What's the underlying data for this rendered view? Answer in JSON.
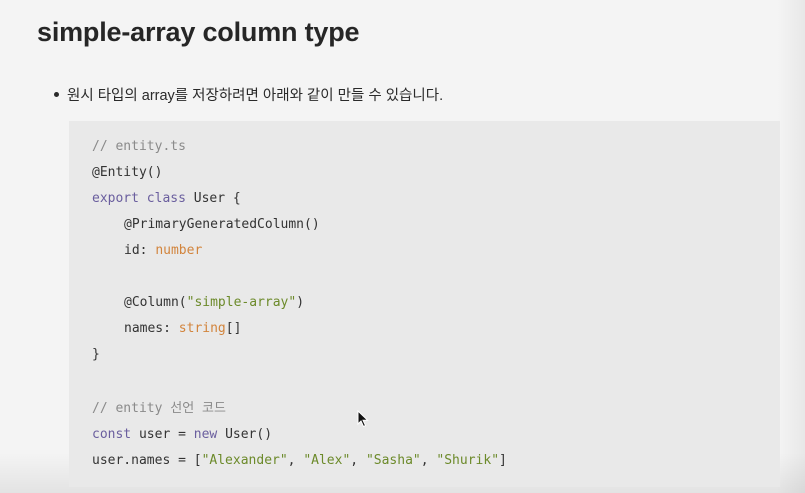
{
  "slide": {
    "title": "simple-array column type",
    "bullet": "원시 타입의 array를 저장하려면 아래와 같이 만들 수 있습니다."
  },
  "code": {
    "l1": {
      "comment": "// entity.ts"
    },
    "l2": {
      "text": "@Entity()"
    },
    "l3": {
      "kw1": "export",
      "kw2": "class",
      "rest": " User {"
    },
    "l4": {
      "text": "@PrimaryGeneratedColumn()"
    },
    "l5": {
      "name": "id: ",
      "type": "number"
    },
    "l6": {
      "pre": "@Column(",
      "str": "\"simple-array\"",
      "post": ")"
    },
    "l7": {
      "name": "names: ",
      "type": "string",
      "post": "[]"
    },
    "l8": {
      "text": "}"
    },
    "l9": {
      "comment": "// entity 선언 코드"
    },
    "l10": {
      "kw1": "const",
      "mid": " user = ",
      "kw2": "new",
      "post": " User()"
    },
    "l11": {
      "pre": "user.names = [",
      "s1": "\"Alexander\"",
      "s2": "\"Alex\"",
      "s3": "\"Sasha\"",
      "s4": "\"Shurik\"",
      "sep": ", ",
      "post": "]"
    }
  },
  "colors": {
    "background": "#f4f4f4",
    "code_background": "#e9e9e9",
    "comment": "#8a8a8a",
    "keyword": "#6a5e9e",
    "type": "#d2843c",
    "string": "#6c8a2a"
  },
  "icons": {
    "cursor": "mouse-pointer-icon"
  }
}
